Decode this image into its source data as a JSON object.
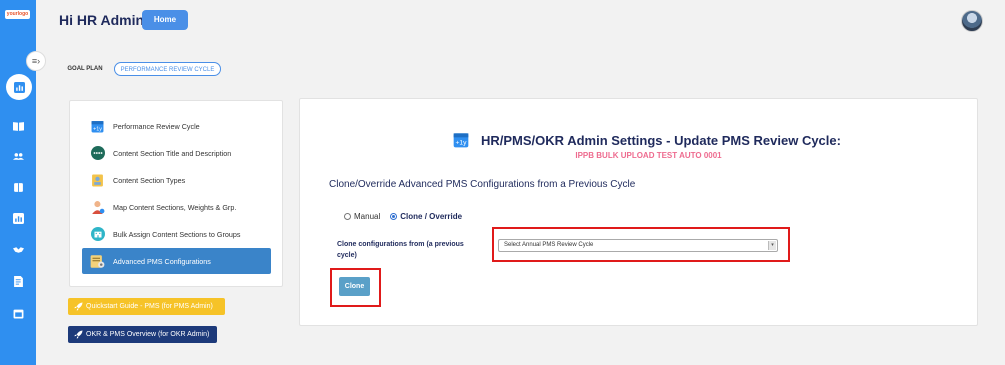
{
  "brand": {
    "logo_text": "yourlogo"
  },
  "header": {
    "greeting": "Hi HR Admin",
    "home_label": "Home"
  },
  "tabs": [
    {
      "label": "GOAL PLAN"
    },
    {
      "label": "PERFORMANCE REVIEW CYCLE"
    }
  ],
  "sidebar_icons": [
    "dashboard-icon",
    "book-icon",
    "users-icon",
    "book-open-icon",
    "chart-icon",
    "handshake-icon",
    "document-icon",
    "calendar-icon"
  ],
  "menu": {
    "items": [
      {
        "label": "Performance Review Cycle",
        "icon": "calendar-plus-icon"
      },
      {
        "label": "Content Section Title and Description",
        "icon": "ellipsis-circle-icon"
      },
      {
        "label": "Content Section Types",
        "icon": "person-badge-icon"
      },
      {
        "label": "Map Content Sections, Weights & Grp.",
        "icon": "person-icon"
      },
      {
        "label": "Bulk Assign Content Sections to Groups",
        "icon": "building-icon"
      },
      {
        "label": "Advanced PMS Configurations",
        "icon": "config-icon",
        "active": true
      }
    ],
    "quickstart_label": "Quickstart Guide - PMS (for PMS Admin)",
    "overview_label": "OKR & PMS Overview (for OKR Admin)"
  },
  "main": {
    "title": "HR/PMS/OKR Admin Settings - Update PMS Review Cycle:",
    "subtitle": "IPPB BULK UPLOAD TEST AUTO 0001",
    "section_heading": "Clone/Override Advanced PMS Configurations from a Previous Cycle",
    "radio_options": [
      {
        "label": "Manual",
        "selected": false
      },
      {
        "label": "Clone / Override",
        "selected": true
      }
    ],
    "clone_from_label": "Clone configurations from (a previous cycle)",
    "select_placeholder": "Select Annual PMS Review Cycle",
    "clone_button": "Clone"
  },
  "colors": {
    "rail": "#2f8ff0",
    "title": "#1f2a5c",
    "subtitle": "#ee6b8f",
    "active_menu": "#3a84c9",
    "quickstart": "#f6c328",
    "overview": "#1d3a7a",
    "highlight": "#e01a1a"
  }
}
